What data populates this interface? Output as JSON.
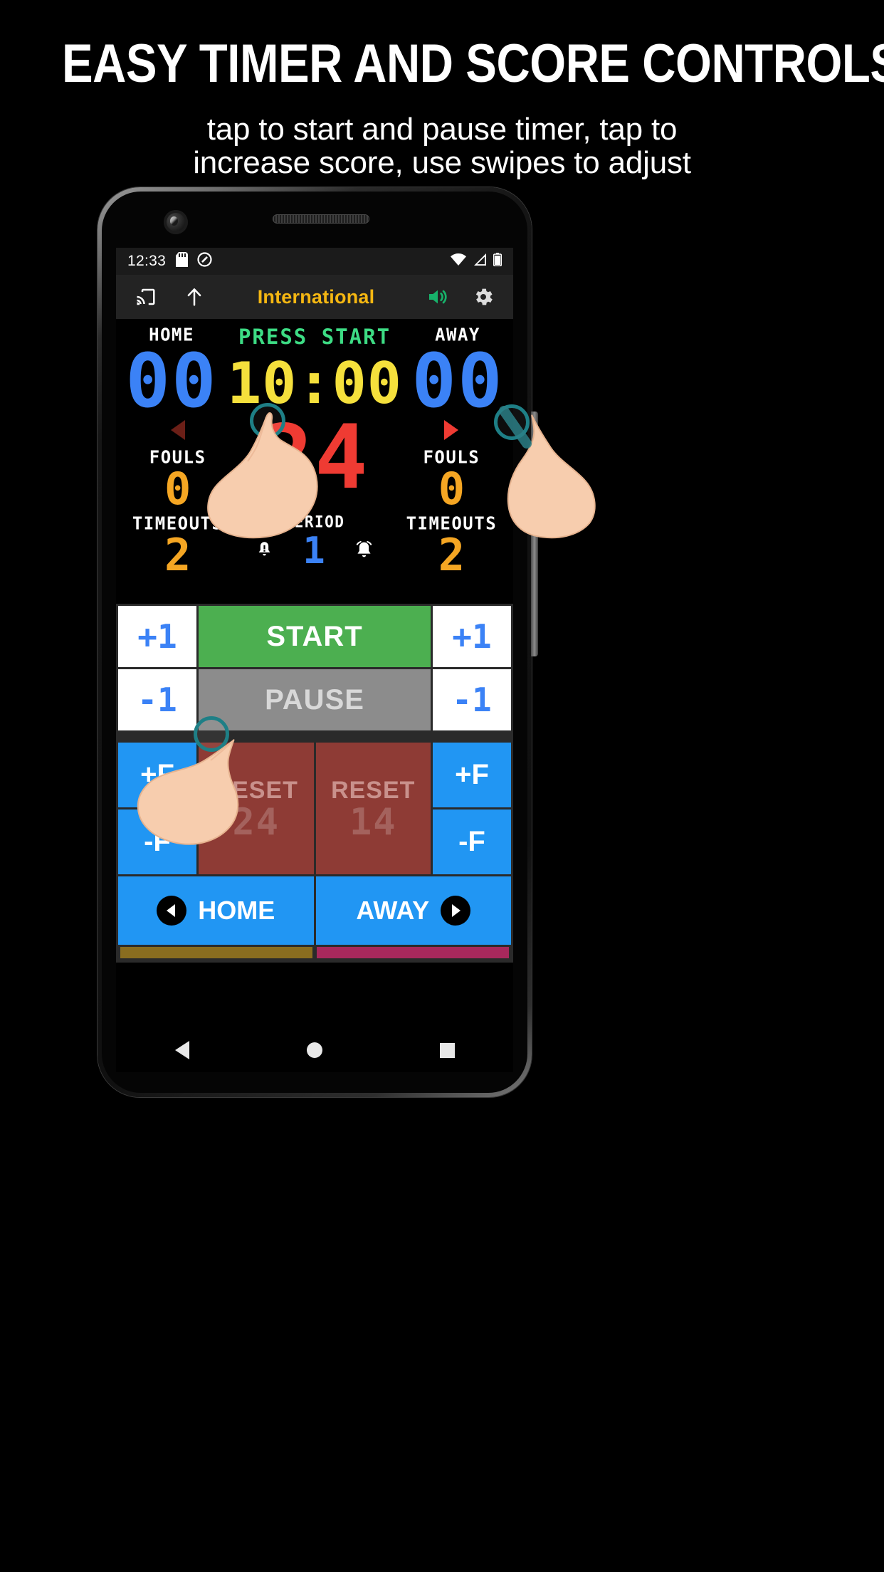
{
  "promo": {
    "title": "EASY TIMER AND SCORE CONTROLS",
    "subtitle_line1": "tap to start and pause timer, tap to",
    "subtitle_line2": "increase score, use swipes to adjust"
  },
  "statusbar": {
    "time": "12:33",
    "icons_left": [
      "sdcard-icon",
      "do-not-disturb-icon"
    ],
    "icons_right": [
      "wifi-icon",
      "signal-icon",
      "battery-icon"
    ]
  },
  "appbar": {
    "cast_icon": "cast-icon",
    "share_icon": "upload-arrow-icon",
    "title": "International",
    "volume_icon": "volume-up-icon",
    "settings_icon": "gear-icon"
  },
  "scoreboard": {
    "home_label": "HOME",
    "home_score": "00",
    "away_label": "AWAY",
    "away_score": "00",
    "status_text": "PRESS START",
    "game_clock": "10:00",
    "shot_clock": "24",
    "fouls_label": "FOULS",
    "home_fouls": "0",
    "away_fouls": "0",
    "timeouts_label": "TIMEOUTS",
    "home_timeouts": "2",
    "away_timeouts": "2",
    "period_label": "PERIOD",
    "period_value": "1",
    "possession_left_icon": "triangle-left-icon",
    "possession_right_icon": "triangle-right-icon",
    "horn_icon": "horn-bell-icon",
    "bell_icon": "alarm-bell-icon"
  },
  "controls": {
    "home_score_plus": "+1",
    "home_score_minus": "-1",
    "away_score_plus": "+1",
    "away_score_minus": "-1",
    "start_label": "START",
    "pause_label": "PAUSE",
    "home_foul_plus": "+F",
    "home_foul_minus": "-F",
    "away_foul_plus": "+F",
    "away_foul_minus": "-F",
    "reset_shot_24_label": "RESET",
    "reset_shot_24_value": "24",
    "reset_shot_14_label": "RESET",
    "reset_shot_14_value": "14",
    "possession_home": "HOME",
    "possession_away": "AWAY"
  },
  "navbar": {
    "back": "back-icon",
    "home": "home-icon",
    "recents": "recents-icon"
  },
  "colors": {
    "accent_title": "#f5b712",
    "score_blue": "#3b82f6",
    "timer_yellow": "#f5e03c",
    "shot_red": "#ef3b33",
    "status_green": "#3ddc84",
    "amber": "#f5a623",
    "start_green": "#4caf50",
    "pause_grey": "#8c8c8c",
    "button_blue": "#2196f3",
    "reset_red": "#8e3b35"
  }
}
